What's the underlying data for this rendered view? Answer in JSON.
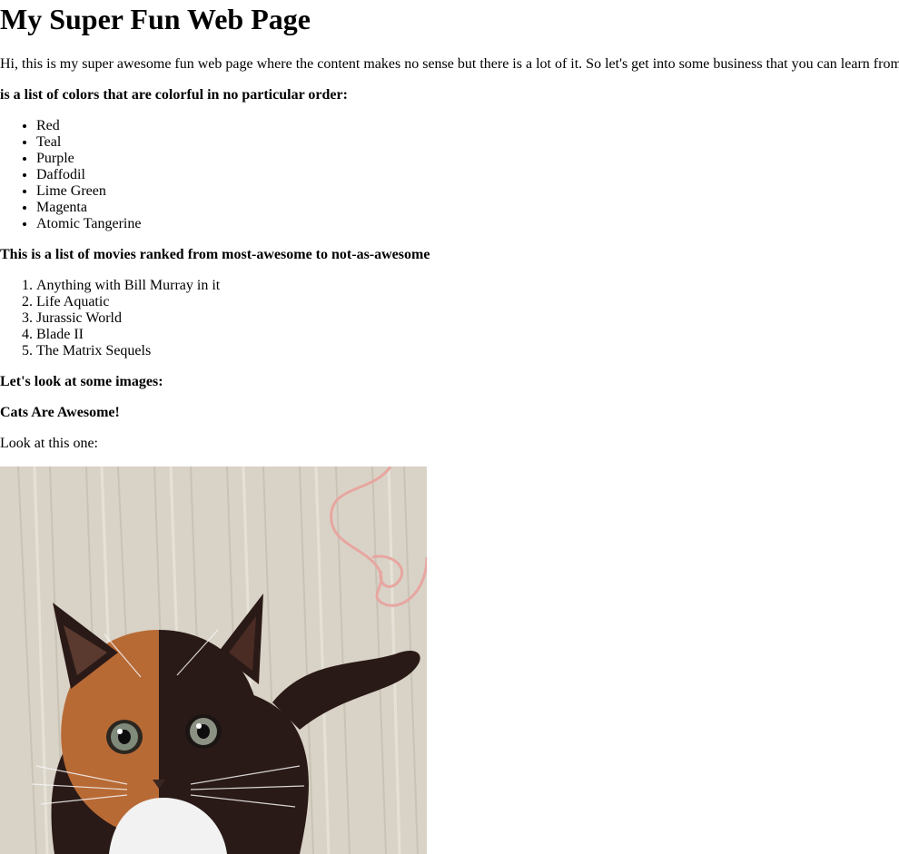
{
  "page_title": "My Super Fun Web Page",
  "intro": "Hi, this is my super awesome fun web page where the content makes no sense but there is a lot of it. So let's get into some business that you can learn from",
  "colors_heading": "is a list of colors that are colorful in no particular order:",
  "colors": [
    "Red",
    "Teal",
    "Purple",
    "Daffodil",
    "Lime Green",
    "Magenta",
    "Atomic Tangerine"
  ],
  "movies_heading": "This is a list of movies ranked from most-awesome to not-as-awesome",
  "movies": [
    "Anything with Bill Murray in it",
    "Life Aquatic",
    "Jurassic World",
    "Blade II",
    "The Matrix Sequels"
  ],
  "images_heading": "Let's look at some images:",
  "cats_heading": "Cats Are Awesome!",
  "look_text": "Look at this one:",
  "image": {
    "subject": "cat-photo",
    "colors": {
      "floor": "#d9d3c7",
      "floor_stripe": "#bdb6a8",
      "fur_dark": "#2a1a17",
      "fur_orange": "#b86a35",
      "fur_white": "#f2f2f2",
      "yarn": "#e7a6a0"
    }
  }
}
